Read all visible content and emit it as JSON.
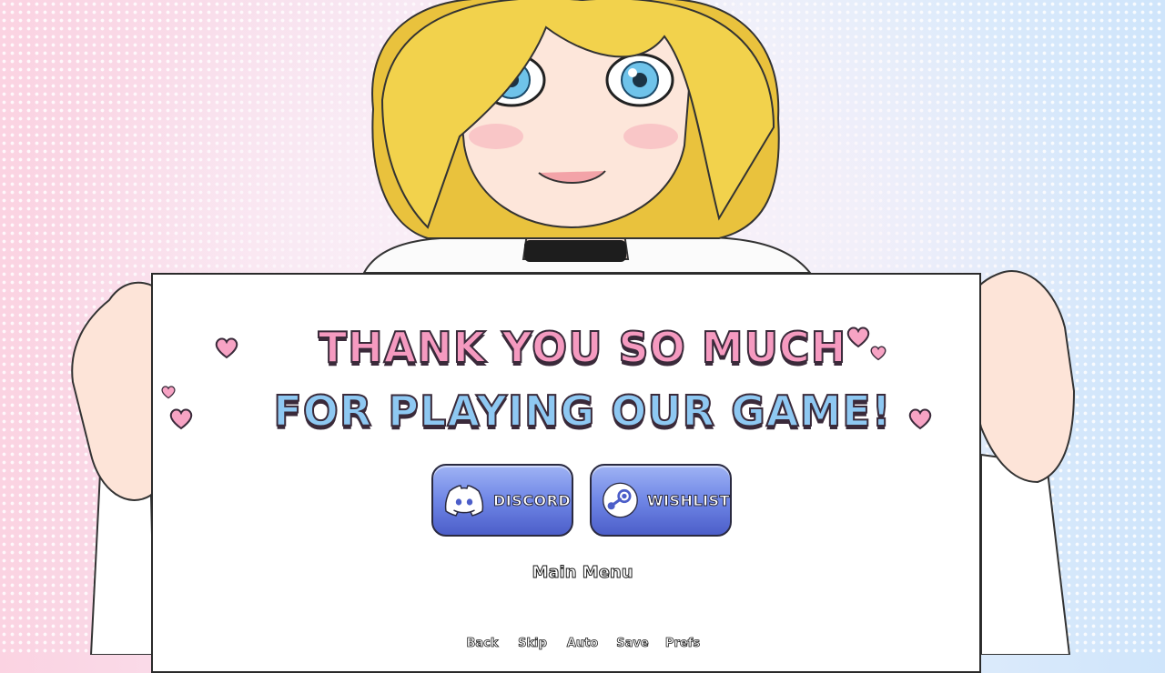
{
  "colors": {
    "bg_left": "#fbd3e2",
    "bg_right": "#cfe5fb",
    "title_pink": "#f59ac0",
    "title_blue": "#8ec8f2",
    "button_blue": "#6f86e6",
    "heart_pink": "#f7a3c4",
    "hair_blonde": "#f2d24c",
    "eye_blue": "#6fc3ea"
  },
  "sign": {
    "line1": "THANK YOU SO MUCH",
    "line2": "FOR PLAYING OUR GAME!"
  },
  "buttons": {
    "discord": {
      "label": "DISCORD",
      "icon": "discord-icon"
    },
    "wishlist": {
      "label": "WISHLIST",
      "icon": "steam-icon"
    }
  },
  "main_menu": {
    "label": "Main Menu"
  },
  "quick_menu": {
    "back": "Back",
    "skip": "Skip",
    "auto": "Auto",
    "save": "Save",
    "prefs": "Prefs"
  }
}
